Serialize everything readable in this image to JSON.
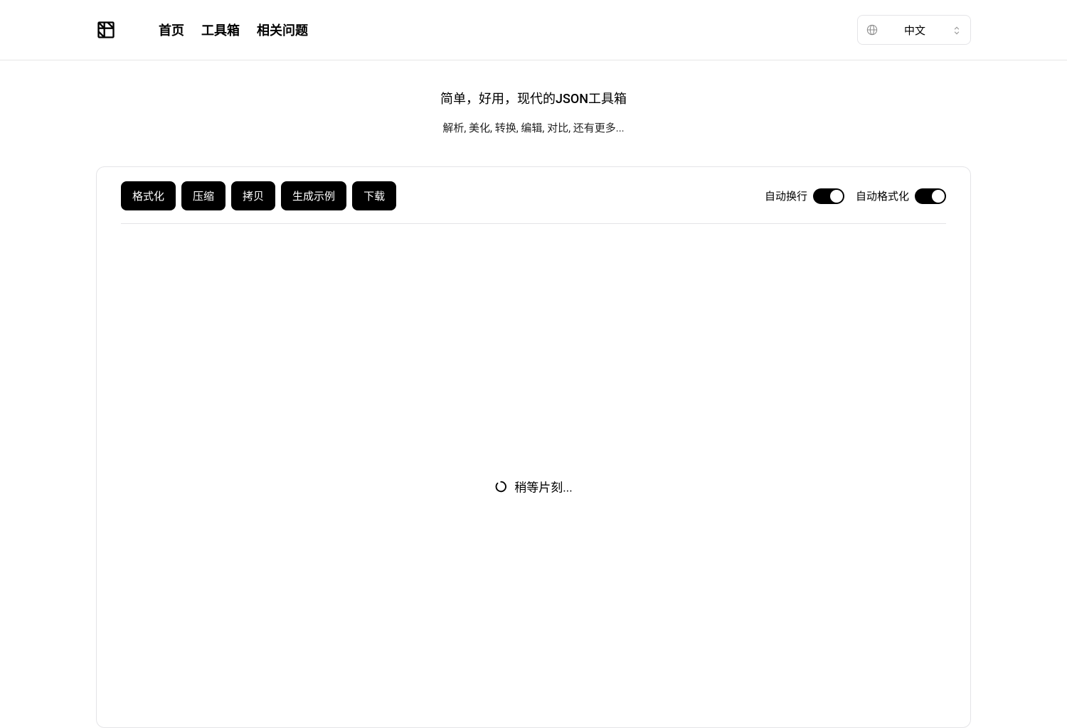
{
  "nav": {
    "items": [
      "首页",
      "工具箱",
      "相关问题"
    ]
  },
  "language": {
    "current": "中文"
  },
  "hero": {
    "title": "简单，好用，现代的JSON工具箱",
    "subtitle": "解析, 美化, 转换, 编辑, 对比, 还有更多..."
  },
  "toolbar": {
    "buttons": {
      "format": "格式化",
      "compress": "压缩",
      "copy": "拷贝",
      "generate": "生成示例",
      "download": "下载"
    },
    "toggles": {
      "wrap_label": "自动换行",
      "autoformat_label": "自动格式化",
      "wrap_on": true,
      "autoformat_on": true
    }
  },
  "loading": {
    "text": "稍等片刻..."
  }
}
